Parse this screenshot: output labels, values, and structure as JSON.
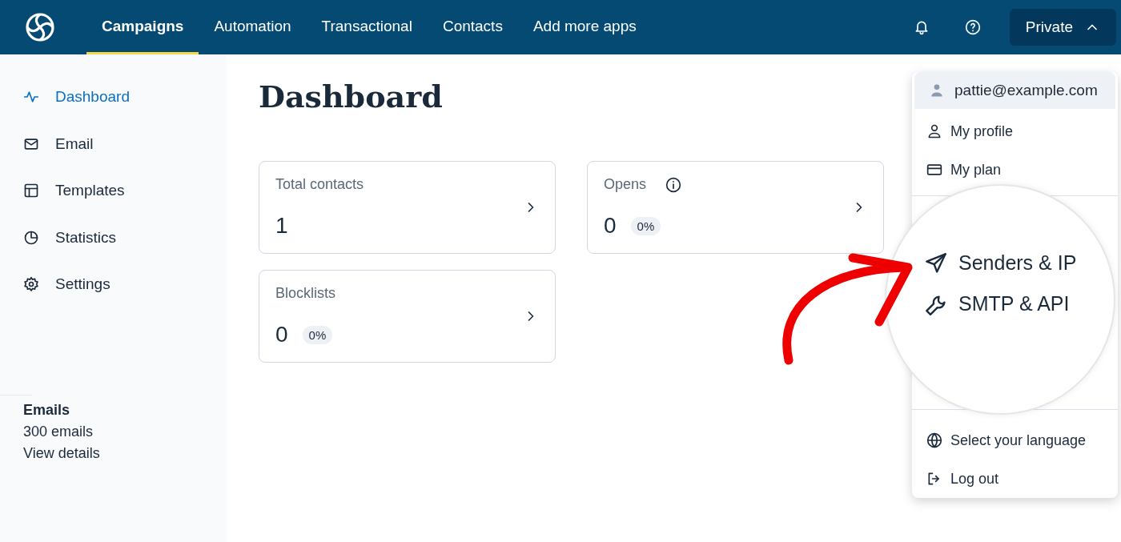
{
  "nav": {
    "items": [
      {
        "label": "Campaigns",
        "selected": true
      },
      {
        "label": "Automation",
        "selected": false
      },
      {
        "label": "Transactional",
        "selected": false
      },
      {
        "label": "Contacts",
        "selected": false
      },
      {
        "label": "Add more apps",
        "selected": false
      }
    ],
    "account": "Private"
  },
  "sidebar": {
    "items": [
      {
        "label": "Dashboard",
        "selected": true
      },
      {
        "label": "Email",
        "selected": false
      },
      {
        "label": "Templates",
        "selected": false
      },
      {
        "label": "Statistics",
        "selected": false
      },
      {
        "label": "Settings",
        "selected": false
      }
    ],
    "plan": {
      "title": "Emails",
      "value": "300 emails",
      "link": "View details"
    }
  },
  "page_title": "Dashboard",
  "cards": [
    {
      "title": "Total contacts",
      "value": "1",
      "info": false
    },
    {
      "title": "Opens",
      "value": "0",
      "badge": "0%",
      "info": true
    },
    {
      "title": "Blocklists",
      "value": "0",
      "badge": "0%",
      "info": false
    }
  ],
  "account_menu": {
    "email": "pattie@example.com",
    "items": [
      "My profile",
      "My plan"
    ],
    "magnified_items": [
      "Senders & IP",
      "SMTP & API"
    ],
    "bottom_items": [
      "Select your language",
      "Log out"
    ]
  }
}
